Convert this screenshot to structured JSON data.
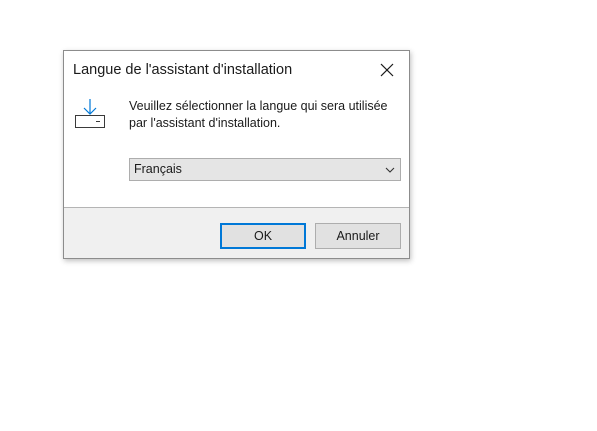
{
  "dialog": {
    "title": "Langue de l'assistant d'installation",
    "message": "Veuillez sélectionner la langue qui sera utilisée par l'assistant d'installation.",
    "language_select": {
      "selected": "Français"
    },
    "buttons": {
      "ok_label": "OK",
      "cancel_label": "Annuler"
    }
  },
  "colors": {
    "accent_focus": "#0078d7",
    "footer_bg": "#f0f0f0",
    "button_bg": "#e1e1e1",
    "icon_accent": "#0078d7"
  },
  "icons": {
    "close": "close-icon",
    "install": "install-icon",
    "dropdown": "chevron-down-icon"
  }
}
